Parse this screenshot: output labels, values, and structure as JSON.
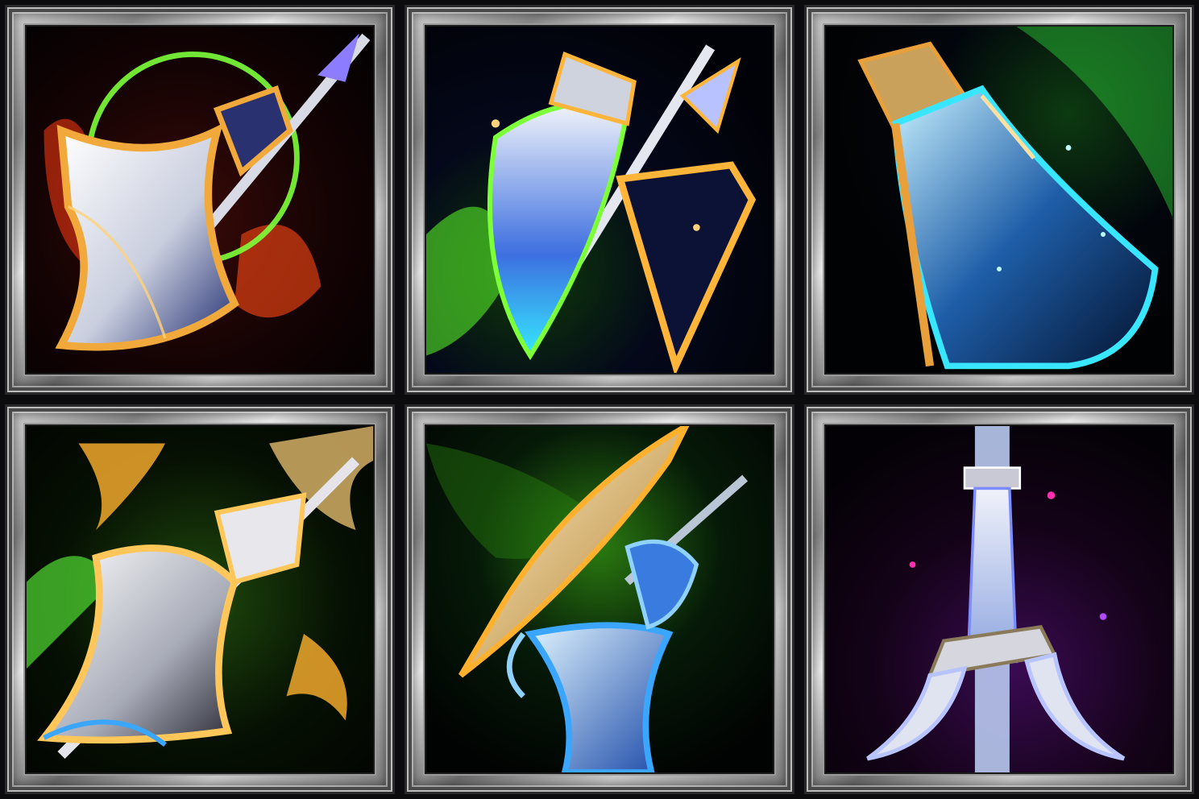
{
  "icons": [
    {
      "name": "flaming-halberd-icon",
      "theme": "fire",
      "bg": "#120204",
      "glow": "#ff5a1a",
      "accent": "#7dff3a",
      "blade": "#e9ecf4",
      "trim": "#f0a93a"
    },
    {
      "name": "emerald-glaive-icon",
      "theme": "nature",
      "bg": "#03060f",
      "glow": "#7dff3a",
      "accent": "#3aa6ff",
      "blade": "#dfe6f3",
      "trim": "#ffb43a"
    },
    {
      "name": "frost-cleaver-icon",
      "theme": "frost",
      "bg": "#020409",
      "glow": "#39e6ff",
      "accent": "#3cff6a",
      "blade": "#cfe9f5",
      "trim": "#e9a03a"
    },
    {
      "name": "verdant-flame-axe-icon",
      "theme": "radiant",
      "bg": "#060a03",
      "glow": "#ffb12e",
      "accent": "#5dff3a",
      "blade": "#e8e8ec",
      "trim": "#ffc65a"
    },
    {
      "name": "twin-spirit-blades-icon",
      "theme": "spirit",
      "bg": "#030805",
      "glow": "#3aa6ff",
      "accent": "#58ff3a",
      "blade": "#f0d59a",
      "trim": "#ffb12e"
    },
    {
      "name": "void-crossblade-icon",
      "theme": "void",
      "bg": "#0b0210",
      "glow": "#b04cff",
      "accent": "#ff2fb0",
      "blade": "#dfe4f0",
      "trim": "#c9c9d6"
    }
  ]
}
